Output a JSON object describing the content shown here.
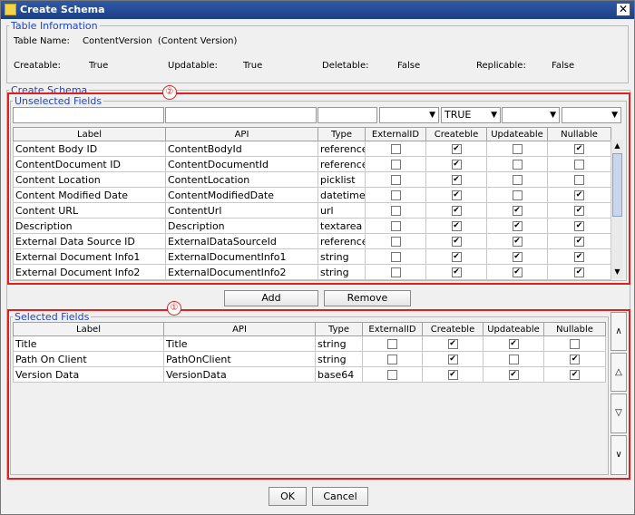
{
  "window": {
    "title": "Create Schema",
    "close_icon": "close-icon"
  },
  "table_info": {
    "legend": "Table Information",
    "table_name_label": "Table Name:",
    "table_name_value": "ContentVersion  (Content Version)",
    "creatable_label": "Creatable:",
    "creatable_value": "True",
    "updatable_label": "Updatable:",
    "updatable_value": "True",
    "deletable_label": "Deletable:",
    "deletable_value": "False",
    "replicable_label": "Replicable:",
    "replicable_value": "False"
  },
  "create_schema": {
    "legend": "Create Schema"
  },
  "annotations": {
    "unselected_marker": "②",
    "selected_marker": "①",
    "marker_color": "#e0201f"
  },
  "columns": {
    "label": "Label",
    "api": "API",
    "type": "Type",
    "external_id": "ExternalID",
    "createble": "Createble",
    "updateable": "Updateable",
    "nullable": "Nullable"
  },
  "unselected": {
    "legend": "Unselected Fields",
    "filters": {
      "label": "",
      "api": "",
      "type": "",
      "external_id": "",
      "createble": "TRUE",
      "updateable": "",
      "nullable": ""
    },
    "rows": [
      {
        "label": "Content Body ID",
        "api": "ContentBodyId",
        "type": "reference",
        "external_id": false,
        "createble": true,
        "updateable": false,
        "nullable": true
      },
      {
        "label": "ContentDocument ID",
        "api": "ContentDocumentId",
        "type": "reference",
        "external_id": false,
        "createble": true,
        "updateable": false,
        "nullable": false
      },
      {
        "label": "Content Location",
        "api": "ContentLocation",
        "type": "picklist",
        "external_id": false,
        "createble": true,
        "updateable": false,
        "nullable": false
      },
      {
        "label": "Content Modified Date",
        "api": "ContentModifiedDate",
        "type": "datetime",
        "external_id": false,
        "createble": true,
        "updateable": false,
        "nullable": true
      },
      {
        "label": "Content URL",
        "api": "ContentUrl",
        "type": "url",
        "external_id": false,
        "createble": true,
        "updateable": true,
        "nullable": true
      },
      {
        "label": "Description",
        "api": "Description",
        "type": "textarea",
        "external_id": false,
        "createble": true,
        "updateable": true,
        "nullable": true
      },
      {
        "label": "External Data Source ID",
        "api": "ExternalDataSourceId",
        "type": "reference",
        "external_id": false,
        "createble": true,
        "updateable": true,
        "nullable": true
      },
      {
        "label": "External Document Info1",
        "api": "ExternalDocumentInfo1",
        "type": "string",
        "external_id": false,
        "createble": true,
        "updateable": true,
        "nullable": true
      },
      {
        "label": "External Document Info2",
        "api": "ExternalDocumentInfo2",
        "type": "string",
        "external_id": false,
        "createble": true,
        "updateable": true,
        "nullable": true
      }
    ]
  },
  "buttons": {
    "add": "Add",
    "remove": "Remove",
    "ok": "OK",
    "cancel": "Cancel"
  },
  "selected": {
    "legend": "Selected Fields",
    "rows": [
      {
        "label": "Title",
        "api": "Title",
        "type": "string",
        "external_id": false,
        "createble": true,
        "updateable": true,
        "nullable": false
      },
      {
        "label": "Path On Client",
        "api": "PathOnClient",
        "type": "string",
        "external_id": false,
        "createble": true,
        "updateable": false,
        "nullable": true
      },
      {
        "label": "Version Data",
        "api": "VersionData",
        "type": "base64",
        "external_id": false,
        "createble": true,
        "updateable": true,
        "nullable": true
      }
    ],
    "side_buttons": [
      "∧",
      "△",
      "▽",
      "∨"
    ]
  }
}
